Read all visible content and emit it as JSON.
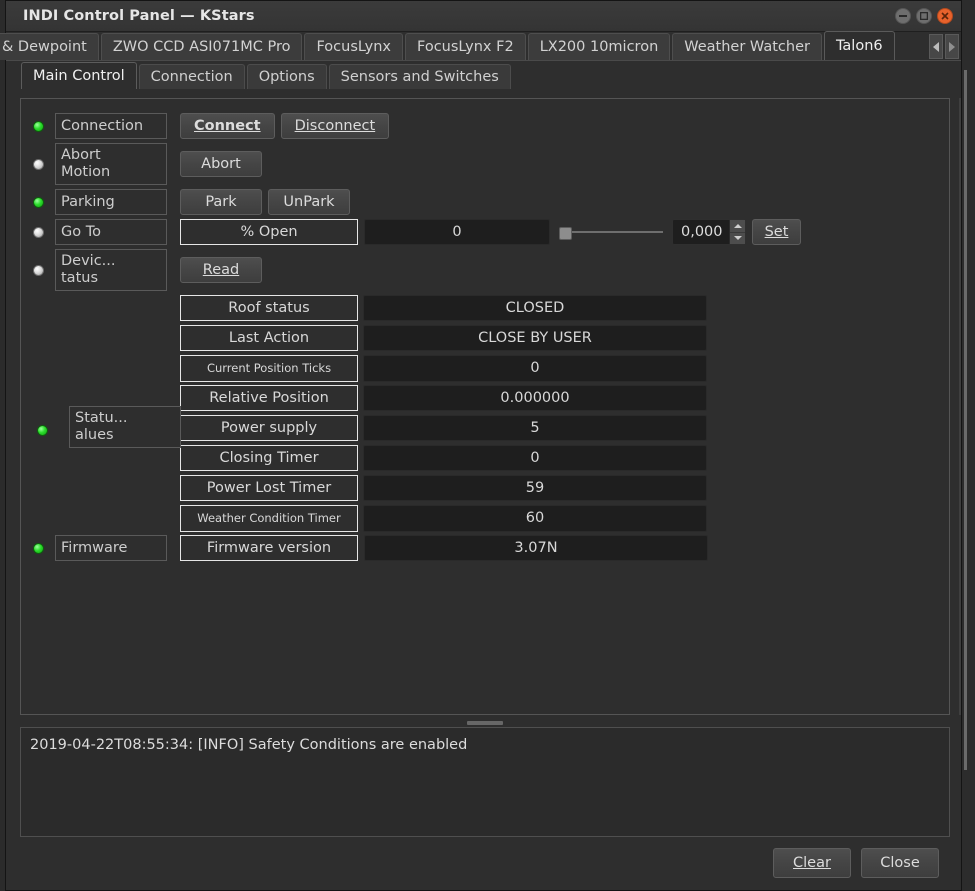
{
  "window": {
    "title": "INDI Control Panel — KStars",
    "controls": {
      "minimize": "minimize-icon",
      "maximize": "maximize-icon",
      "close": "close-icon"
    }
  },
  "device_tabs": {
    "items": [
      {
        "label": "& Dewpoint",
        "active": false,
        "clipped": true
      },
      {
        "label": "ZWO CCD ASI071MC Pro",
        "active": false
      },
      {
        "label": "FocusLynx",
        "active": false
      },
      {
        "label": "FocusLynx F2",
        "active": false
      },
      {
        "label": "LX200 10micron",
        "active": false
      },
      {
        "label": "Weather Watcher",
        "active": false
      },
      {
        "label": "Talon6",
        "active": true
      }
    ],
    "scroll_left": "chevron-left-icon",
    "scroll_right": "chevron-right-icon"
  },
  "property_tabs": {
    "items": [
      {
        "label": "Main Control",
        "active": true
      },
      {
        "label": "Connection",
        "active": false
      },
      {
        "label": "Options",
        "active": false
      },
      {
        "label": "Sensors and Switches",
        "active": false
      }
    ]
  },
  "main": {
    "rows": [
      {
        "name": "connection",
        "led": "green",
        "label": "Connection",
        "buttons": [
          {
            "label": "Connect",
            "bold": true
          },
          {
            "label": "Disconnect",
            "bold": false
          }
        ]
      },
      {
        "name": "abort-motion",
        "led": "idle",
        "label": "Abort\nMotion",
        "label_line1": "Abort",
        "label_line2": "Motion",
        "buttons": [
          {
            "label": "Abort",
            "bold": false
          }
        ]
      },
      {
        "name": "parking",
        "led": "green",
        "label": "Parking",
        "buttons": [
          {
            "label": "Park",
            "bold": false
          },
          {
            "label": "UnPark",
            "bold": false
          }
        ]
      },
      {
        "name": "go-to",
        "led": "idle",
        "label": "Go To",
        "field_label": "% Open",
        "field_value": "0",
        "slider_value": 0,
        "spin_value": "0,000",
        "set_label": "Set"
      },
      {
        "name": "device-status",
        "led": "idle",
        "label_line1": "Devic...",
        "label_line2": "tatus",
        "buttons": [
          {
            "label": "Read",
            "bold": false
          }
        ]
      }
    ],
    "status_group": {
      "led": "green",
      "label_line1": "Statu...",
      "label_line2": "alues",
      "entries": [
        {
          "label": "Roof status",
          "value": "CLOSED",
          "small": false
        },
        {
          "label": "Last Action",
          "value": "CLOSE BY USER",
          "small": false
        },
        {
          "label": "Current Position Ticks",
          "value": "0",
          "small": true
        },
        {
          "label": "Relative Position",
          "value": "0.000000",
          "small": false
        },
        {
          "label": "Power supply",
          "value": "5",
          "small": false
        },
        {
          "label": "Closing Timer",
          "value": "0",
          "small": false
        },
        {
          "label": "Power Lost Timer",
          "value": "59",
          "small": false
        },
        {
          "label": "Weather Condition Timer",
          "value": "60",
          "small": true
        }
      ]
    },
    "firmware_group": {
      "led": "green",
      "label": "Firmware",
      "entries": [
        {
          "label": "Firmware version",
          "value": "3.07N",
          "small": false
        }
      ]
    }
  },
  "log": {
    "lines": [
      "2019-04-22T08:55:34: [INFO] Safety Conditions are enabled"
    ]
  },
  "footer": {
    "clear_label": "Clear",
    "close_label": "Close"
  },
  "colors": {
    "led_on": "#2bdc2b",
    "led_idle": "#dcdcdc",
    "close_button": "#e8622c",
    "window_bg": "#2e2e2e",
    "field_bg": "#1e1e1e"
  }
}
